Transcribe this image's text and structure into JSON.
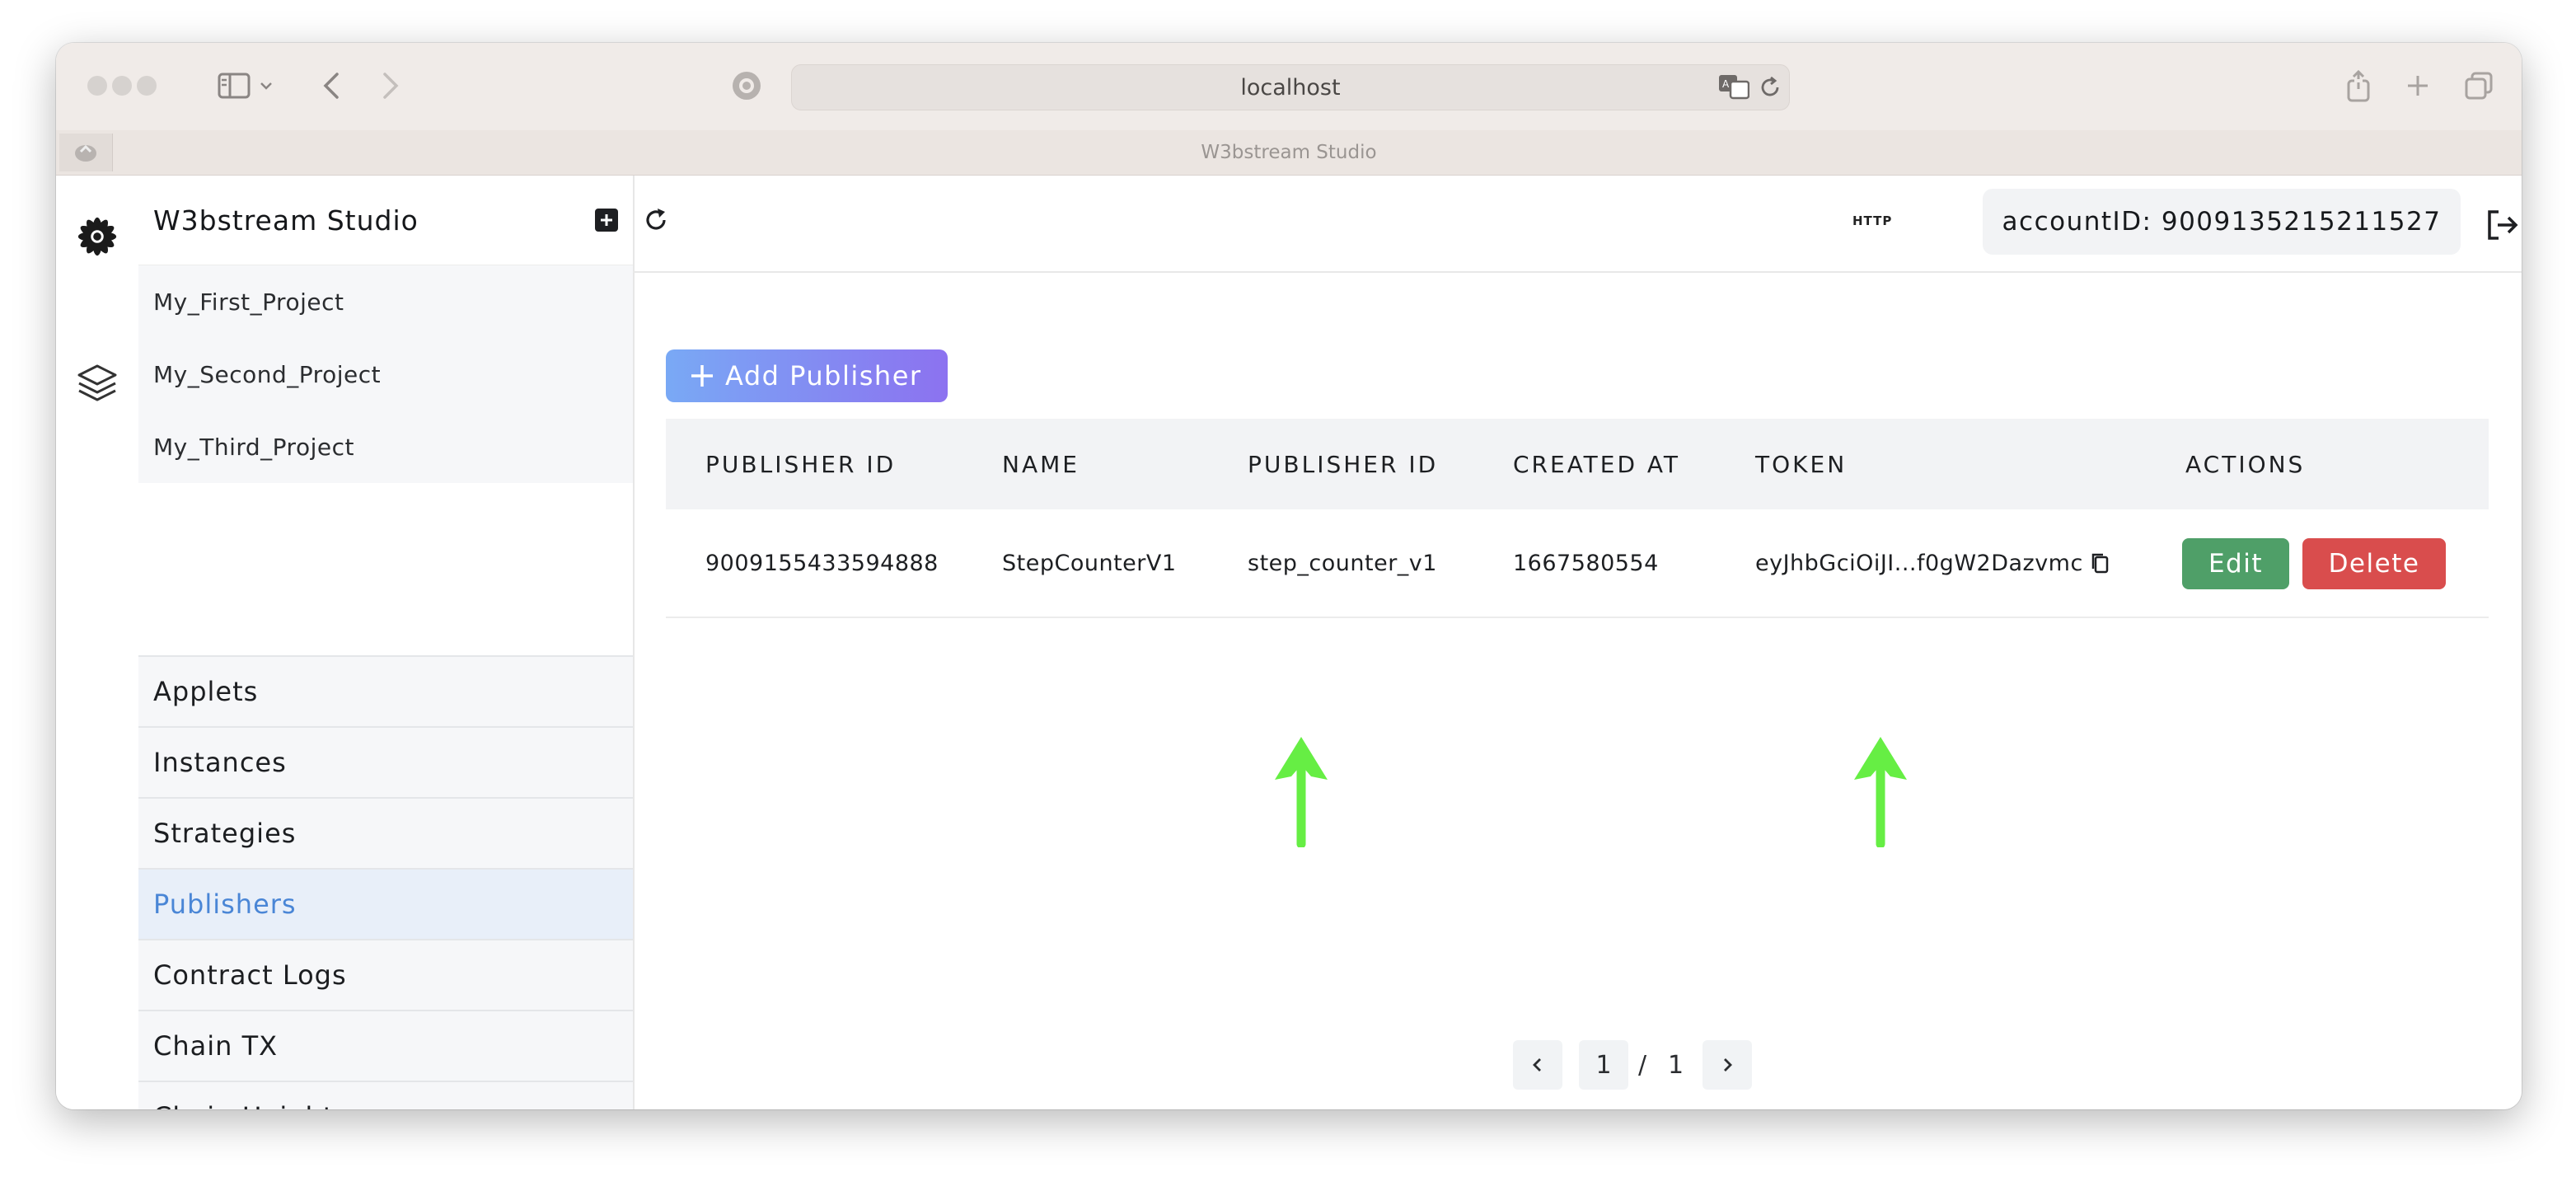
{
  "browser": {
    "url": "localhost",
    "tab_title": "W3bstream Studio"
  },
  "sidebar": {
    "app_title": "W3bstream Studio",
    "projects": [
      {
        "label": "My_First_Project"
      },
      {
        "label": "My_Second_Project"
      },
      {
        "label": "My_Third_Project"
      }
    ],
    "menu": [
      {
        "label": "Applets"
      },
      {
        "label": "Instances"
      },
      {
        "label": "Strategies"
      },
      {
        "label": "Publishers",
        "active": true
      },
      {
        "label": "Contract Logs"
      },
      {
        "label": "Chain TX"
      },
      {
        "label": "Chain Height"
      }
    ]
  },
  "topbar": {
    "http_label": "HTTP",
    "account": "accountID: 9009135215211527"
  },
  "toolbar": {
    "add_label": "Add Publisher"
  },
  "table": {
    "columns": [
      "PUBLISHER ID",
      "NAME",
      "PUBLISHER ID",
      "CREATED AT",
      "TOKEN",
      "ACTIONS"
    ],
    "rows": [
      {
        "id": "9009155433594888",
        "name": "StepCounterV1",
        "key": "step_counter_v1",
        "created_at": "1667580554",
        "token": "eyJhbGciOiJI...f0gW2Dazvmc",
        "edit_label": "Edit",
        "delete_label": "Delete"
      }
    ]
  },
  "pagination": {
    "current": "1",
    "separator": "/",
    "total": "1"
  },
  "colors": {
    "accent": "#4a86d6",
    "annotation_arrow": "#66ee44",
    "edit": "#4f9f68",
    "delete": "#d94d4d"
  },
  "icons": [
    "sidebar-toggle-icon",
    "back-icon",
    "forward-icon",
    "reload-icon",
    "share-icon",
    "new-tab-icon",
    "tabs-overview-icon",
    "logo-icon",
    "layers-icon",
    "add-project-icon",
    "refresh-icon",
    "logout-icon",
    "copy-icon",
    "plus-icon"
  ]
}
